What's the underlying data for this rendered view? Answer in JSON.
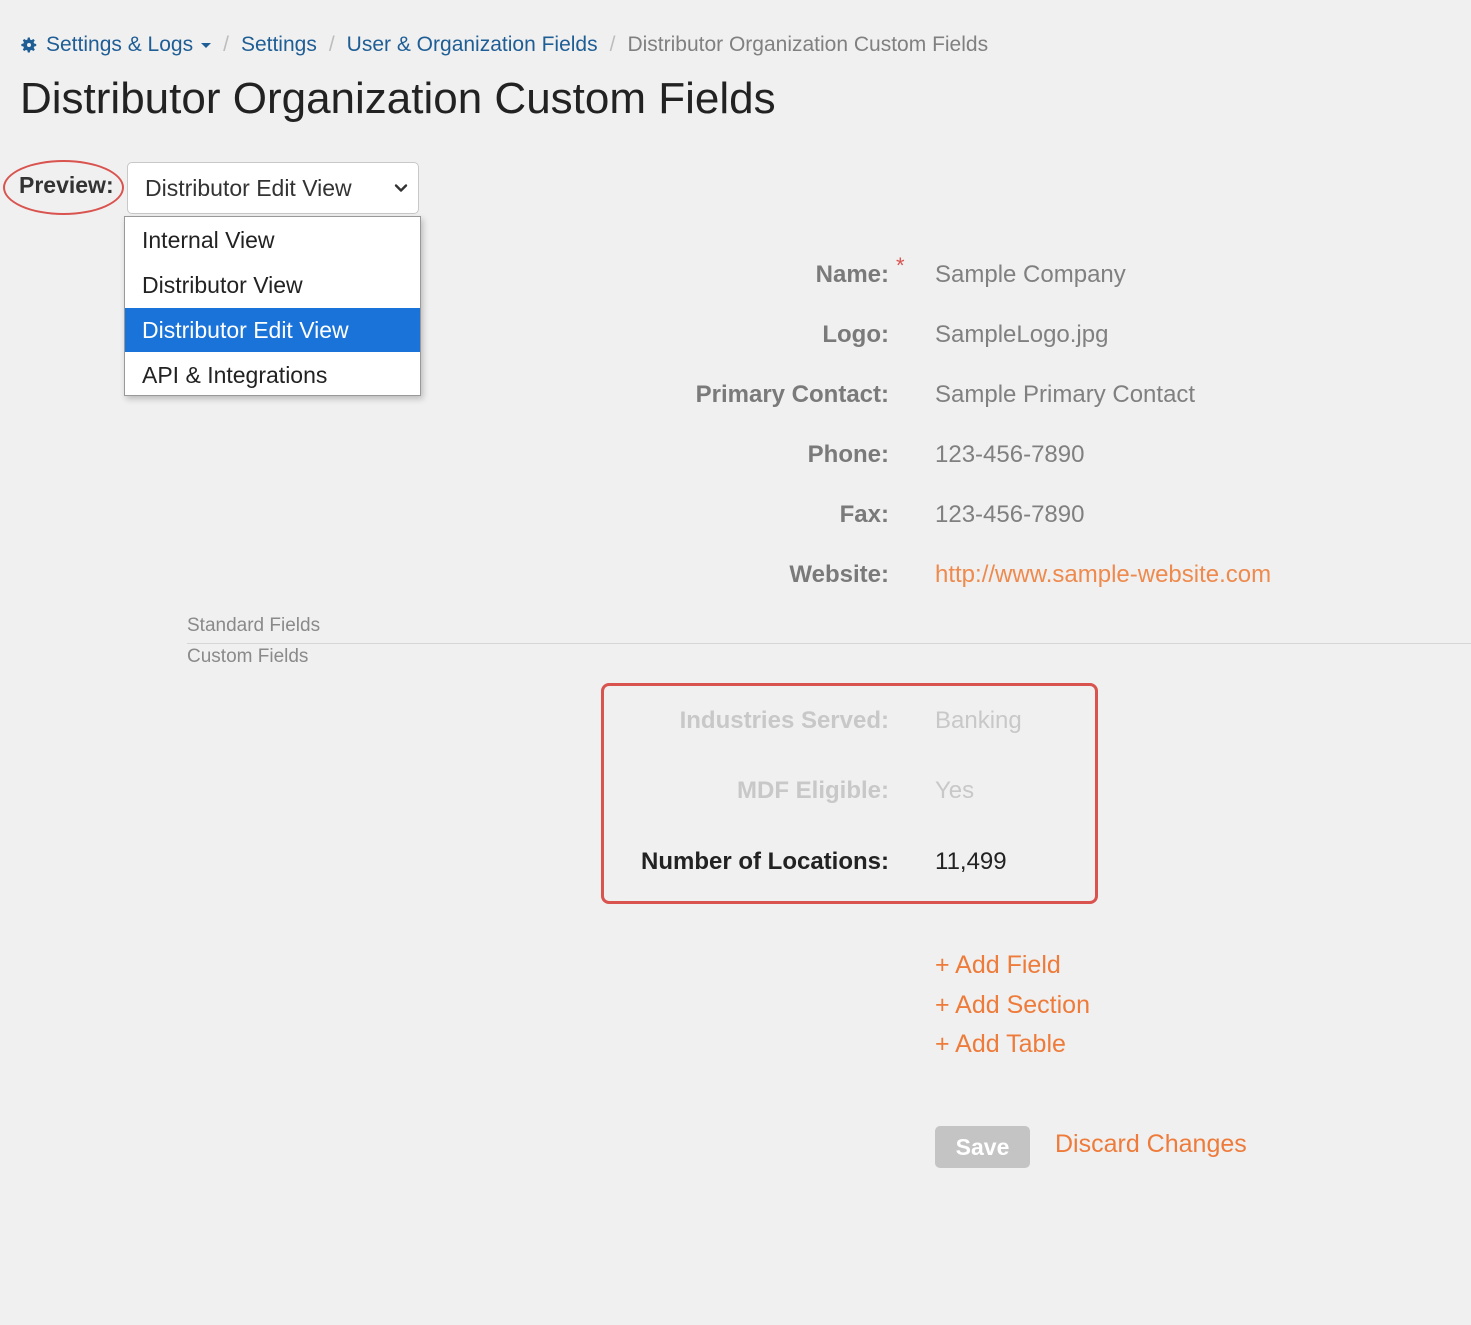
{
  "breadcrumb": {
    "items": [
      "Settings & Logs",
      "Settings",
      "User & Organization Fields"
    ],
    "current": "Distributor Organization Custom Fields",
    "separator": "/"
  },
  "page": {
    "title": "Distributor Organization Custom Fields"
  },
  "preview": {
    "label": "Preview:",
    "selected": "Distributor Edit View",
    "options": [
      "Internal View",
      "Distributor View",
      "Distributor Edit View",
      "API & Integrations"
    ]
  },
  "standard_fields": [
    {
      "label": "Name:",
      "value": "Sample Company",
      "required_mark": "*"
    },
    {
      "label": "Logo:",
      "value": "SampleLogo.jpg"
    },
    {
      "label": "Primary Contact:",
      "value": "Sample Primary Contact"
    },
    {
      "label": "Phone:",
      "value": "123-456-7890"
    },
    {
      "label": "Fax:",
      "value": "123-456-7890"
    },
    {
      "label": "Website:",
      "value": "http://www.sample-website.com"
    }
  ],
  "sections": {
    "standard": "Standard Fields",
    "custom": "Custom Fields"
  },
  "custom_fields": [
    {
      "label": "Industries Served:",
      "value": "Banking"
    },
    {
      "label": "MDF Eligible:",
      "value": "Yes"
    },
    {
      "label": "Number of Locations:",
      "value": "11,499"
    }
  ],
  "actions": {
    "add_field": "+ Add Field",
    "add_section": "+ Add Section",
    "add_table": "+ Add Table",
    "save": "Save",
    "discard": "Discard Changes"
  },
  "colors": {
    "link_blue": "#1f5e95",
    "accent_orange": "#ee7b3a",
    "highlight_red": "#d9534f",
    "selected_option": "#1a73d9"
  }
}
